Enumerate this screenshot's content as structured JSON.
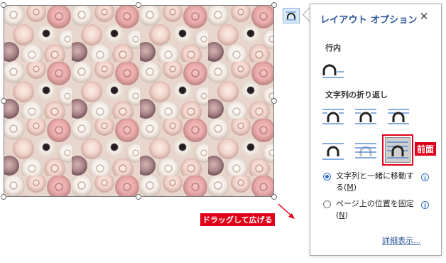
{
  "panel": {
    "title": "レイアウト オプション",
    "close_label": "✕",
    "section_inline": "行内",
    "section_wrap": "文字列の折り返し",
    "radio_move_label_1": "文字列と一緒に移動す",
    "radio_move_label_2a": "る(",
    "radio_move_key": "M",
    "radio_move_label_2b": ")",
    "radio_fix_label_1": "ページ上の位置を固定",
    "radio_fix_label_2a": "(",
    "radio_fix_key": "N",
    "radio_fix_label_2b": ")",
    "info_glyph": "i",
    "more_link": "詳細表示..."
  },
  "annotations": {
    "front_label": "前面",
    "drag_label": "ドラッグして広げる"
  },
  "colors": {
    "accent_blue": "#2b579a",
    "highlight_red": "#e0001a",
    "selected_bg": "#d0d0d0"
  }
}
